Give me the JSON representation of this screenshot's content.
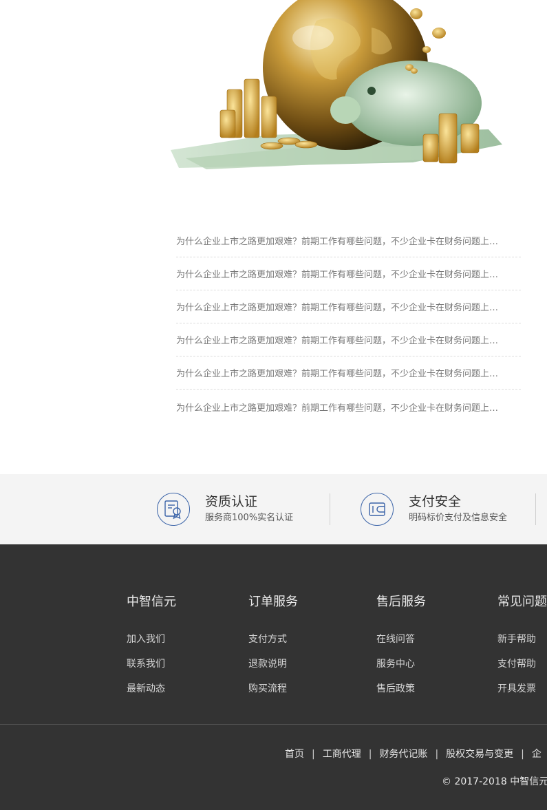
{
  "news": {
    "items": [
      "为什么企业上市之路更加艰难？前期工作有哪些问题，不少企业卡在财务问题上…",
      "为什么企业上市之路更加艰难？前期工作有哪些问题，不少企业卡在财务问题上…",
      "为什么企业上市之路更加艰难？前期工作有哪些问题，不少企业卡在财务问题上…",
      "为什么企业上市之路更加艰难？前期工作有哪些问题，不少企业卡在财务问题上…",
      "为什么企业上市之路更加艰难？前期工作有哪些问题，不少企业卡在财务问题上…",
      "为什么企业上市之路更加艰难？前期工作有哪些问题，不少企业卡在财务问题上…"
    ]
  },
  "features": [
    {
      "title": "资质认证",
      "desc": "服务商100%实名认证",
      "icon": "certificate-icon"
    },
    {
      "title": "支付安全",
      "desc": "明码标价支付及信息安全",
      "icon": "wallet-icon"
    }
  ],
  "footer": {
    "columns": [
      {
        "title": "中智信元",
        "links": [
          "加入我们",
          "联系我们",
          "最新动态"
        ]
      },
      {
        "title": "订单服务",
        "links": [
          "支付方式",
          "退款说明",
          "购买流程"
        ]
      },
      {
        "title": "售后服务",
        "links": [
          "在线问答",
          "服务中心",
          "售后政策"
        ]
      },
      {
        "title": "常见问题",
        "links": [
          "新手帮助",
          "支付帮助",
          "开具发票"
        ]
      }
    ],
    "nav": [
      "首页",
      "工商代理",
      "财务代记账",
      "股权交易与变更",
      "企"
    ],
    "nav_separator": "|",
    "copyright": "© 2017-2018 中智信元"
  },
  "colors": {
    "accent": "#3a63a8",
    "footer_bg": "#333333",
    "band_bg": "#f4f4f4"
  }
}
